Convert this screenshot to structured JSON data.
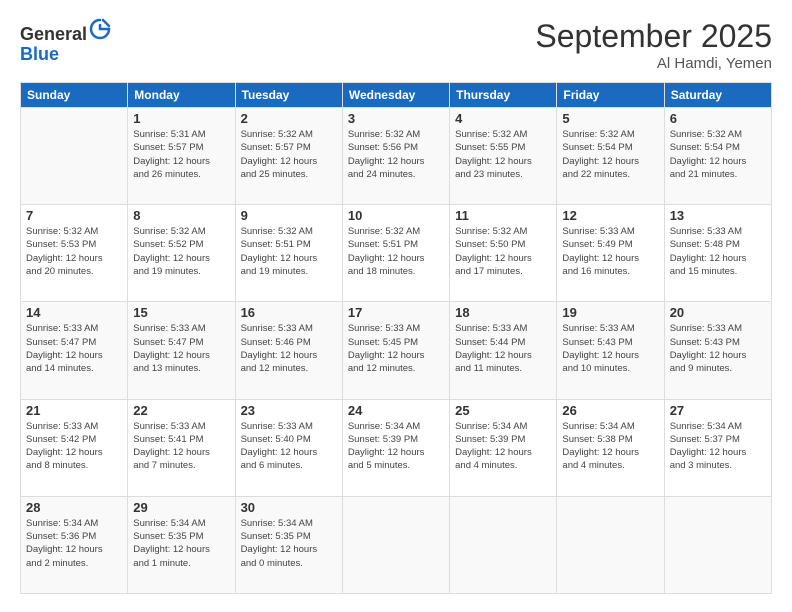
{
  "header": {
    "logo_general": "General",
    "logo_blue": "Blue",
    "month_title": "September 2025",
    "location": "Al Hamdi, Yemen"
  },
  "days_of_week": [
    "Sunday",
    "Monday",
    "Tuesday",
    "Wednesday",
    "Thursday",
    "Friday",
    "Saturday"
  ],
  "weeks": [
    [
      {
        "day": "",
        "info": ""
      },
      {
        "day": "1",
        "info": "Sunrise: 5:31 AM\nSunset: 5:57 PM\nDaylight: 12 hours\nand 26 minutes."
      },
      {
        "day": "2",
        "info": "Sunrise: 5:32 AM\nSunset: 5:57 PM\nDaylight: 12 hours\nand 25 minutes."
      },
      {
        "day": "3",
        "info": "Sunrise: 5:32 AM\nSunset: 5:56 PM\nDaylight: 12 hours\nand 24 minutes."
      },
      {
        "day": "4",
        "info": "Sunrise: 5:32 AM\nSunset: 5:55 PM\nDaylight: 12 hours\nand 23 minutes."
      },
      {
        "day": "5",
        "info": "Sunrise: 5:32 AM\nSunset: 5:54 PM\nDaylight: 12 hours\nand 22 minutes."
      },
      {
        "day": "6",
        "info": "Sunrise: 5:32 AM\nSunset: 5:54 PM\nDaylight: 12 hours\nand 21 minutes."
      }
    ],
    [
      {
        "day": "7",
        "info": "Sunrise: 5:32 AM\nSunset: 5:53 PM\nDaylight: 12 hours\nand 20 minutes."
      },
      {
        "day": "8",
        "info": "Sunrise: 5:32 AM\nSunset: 5:52 PM\nDaylight: 12 hours\nand 19 minutes."
      },
      {
        "day": "9",
        "info": "Sunrise: 5:32 AM\nSunset: 5:51 PM\nDaylight: 12 hours\nand 19 minutes."
      },
      {
        "day": "10",
        "info": "Sunrise: 5:32 AM\nSunset: 5:51 PM\nDaylight: 12 hours\nand 18 minutes."
      },
      {
        "day": "11",
        "info": "Sunrise: 5:32 AM\nSunset: 5:50 PM\nDaylight: 12 hours\nand 17 minutes."
      },
      {
        "day": "12",
        "info": "Sunrise: 5:33 AM\nSunset: 5:49 PM\nDaylight: 12 hours\nand 16 minutes."
      },
      {
        "day": "13",
        "info": "Sunrise: 5:33 AM\nSunset: 5:48 PM\nDaylight: 12 hours\nand 15 minutes."
      }
    ],
    [
      {
        "day": "14",
        "info": "Sunrise: 5:33 AM\nSunset: 5:47 PM\nDaylight: 12 hours\nand 14 minutes."
      },
      {
        "day": "15",
        "info": "Sunrise: 5:33 AM\nSunset: 5:47 PM\nDaylight: 12 hours\nand 13 minutes."
      },
      {
        "day": "16",
        "info": "Sunrise: 5:33 AM\nSunset: 5:46 PM\nDaylight: 12 hours\nand 12 minutes."
      },
      {
        "day": "17",
        "info": "Sunrise: 5:33 AM\nSunset: 5:45 PM\nDaylight: 12 hours\nand 12 minutes."
      },
      {
        "day": "18",
        "info": "Sunrise: 5:33 AM\nSunset: 5:44 PM\nDaylight: 12 hours\nand 11 minutes."
      },
      {
        "day": "19",
        "info": "Sunrise: 5:33 AM\nSunset: 5:43 PM\nDaylight: 12 hours\nand 10 minutes."
      },
      {
        "day": "20",
        "info": "Sunrise: 5:33 AM\nSunset: 5:43 PM\nDaylight: 12 hours\nand 9 minutes."
      }
    ],
    [
      {
        "day": "21",
        "info": "Sunrise: 5:33 AM\nSunset: 5:42 PM\nDaylight: 12 hours\nand 8 minutes."
      },
      {
        "day": "22",
        "info": "Sunrise: 5:33 AM\nSunset: 5:41 PM\nDaylight: 12 hours\nand 7 minutes."
      },
      {
        "day": "23",
        "info": "Sunrise: 5:33 AM\nSunset: 5:40 PM\nDaylight: 12 hours\nand 6 minutes."
      },
      {
        "day": "24",
        "info": "Sunrise: 5:34 AM\nSunset: 5:39 PM\nDaylight: 12 hours\nand 5 minutes."
      },
      {
        "day": "25",
        "info": "Sunrise: 5:34 AM\nSunset: 5:39 PM\nDaylight: 12 hours\nand 4 minutes."
      },
      {
        "day": "26",
        "info": "Sunrise: 5:34 AM\nSunset: 5:38 PM\nDaylight: 12 hours\nand 4 minutes."
      },
      {
        "day": "27",
        "info": "Sunrise: 5:34 AM\nSunset: 5:37 PM\nDaylight: 12 hours\nand 3 minutes."
      }
    ],
    [
      {
        "day": "28",
        "info": "Sunrise: 5:34 AM\nSunset: 5:36 PM\nDaylight: 12 hours\nand 2 minutes."
      },
      {
        "day": "29",
        "info": "Sunrise: 5:34 AM\nSunset: 5:35 PM\nDaylight: 12 hours\nand 1 minute."
      },
      {
        "day": "30",
        "info": "Sunrise: 5:34 AM\nSunset: 5:35 PM\nDaylight: 12 hours\nand 0 minutes."
      },
      {
        "day": "",
        "info": ""
      },
      {
        "day": "",
        "info": ""
      },
      {
        "day": "",
        "info": ""
      },
      {
        "day": "",
        "info": ""
      }
    ]
  ]
}
